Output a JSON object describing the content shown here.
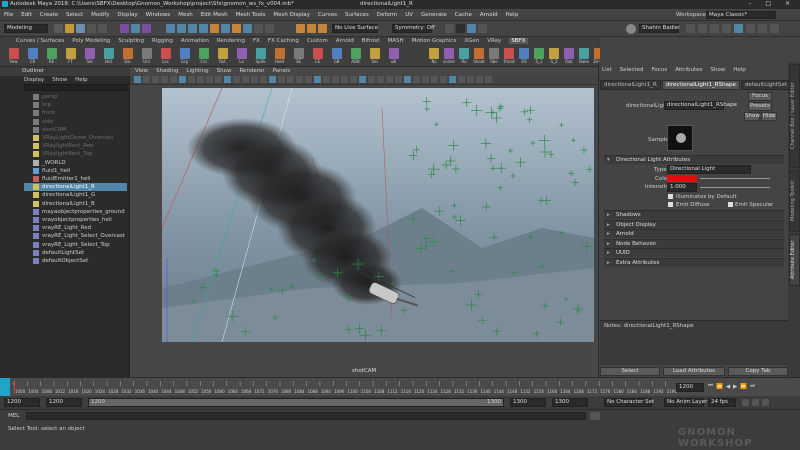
{
  "title_bar": {
    "title": "Autodesk Maya 2018: C:\\Users\\SBFX\\Desktop\\Gnomon_Workshop\\project\\Sfx\\gnomon_ws_fx_v004.mb*",
    "center": "directionalLight1_R",
    "window_controls": "– □ ×"
  },
  "menu_bar": {
    "items": [
      "File",
      "Edit",
      "Create",
      "Select",
      "Modify",
      "Display",
      "Windows",
      "Mesh",
      "Edit Mesh",
      "Mesh Tools",
      "Mesh Display",
      "Curves",
      "Surfaces",
      "Deform",
      "UV",
      "Generate",
      "Cache",
      "Arnold",
      "Help"
    ],
    "workspace_label": "Workspace :",
    "workspace_value": "Maya Classic*"
  },
  "status_line": {
    "menu_set": "Modeling",
    "live_surface": "No Live Surface",
    "symmetry": "Symmetry: Off",
    "user": "Shahin Badiei"
  },
  "shelf": {
    "tabs": [
      "Curves / Surfaces",
      "Poly Modeling",
      "Sculpting",
      "Rigging",
      "Animation",
      "Rendering",
      "FX",
      "FX Caching",
      "Custom",
      "Arnold",
      "Bifrost",
      "MASH",
      "Motion Graphics",
      "XGen",
      "VRay",
      "SBFX"
    ],
    "active_tab": "SBFX",
    "icon_labels": [
      "Vew",
      "CR",
      "RE",
      "FT",
      "Sel",
      "Hid",
      "Dis",
      "Unl",
      "Loc",
      "Grp",
      "Cel",
      "Rst",
      "Lo",
      "SpSk",
      "Hold",
      "SE",
      "CE",
      "GB",
      "ADB",
      "Sel",
      "uB"
    ],
    "right_icon_labels": [
      "Ns",
      "scene",
      "Ro",
      "Shoot",
      "Sbe",
      "Trand",
      "OS",
      "S_1",
      "S_2",
      "Rak",
      "Bake",
      "Zoom"
    ]
  },
  "toolbox": {
    "tools": [
      "select-tool",
      "lasso-tool",
      "paint-select-tool",
      "move-tool",
      "rotate-tool",
      "scale-tool",
      "last-tool"
    ]
  },
  "outliner": {
    "title": "Outliner",
    "menus": [
      "Display",
      "Show",
      "Help"
    ],
    "items": [
      {
        "label": "persp",
        "dim": true,
        "icon": "camera-icon"
      },
      {
        "label": "top",
        "dim": true,
        "icon": "camera-icon"
      },
      {
        "label": "front",
        "dim": true,
        "icon": "camera-icon"
      },
      {
        "label": "side",
        "dim": true,
        "icon": "camera-icon"
      },
      {
        "label": "shotCAM",
        "dim": true,
        "icon": "camera-icon"
      },
      {
        "label": "VRayLightDome_Overcast",
        "dim": true,
        "icon": "light-icon"
      },
      {
        "label": "VRaylightRect_Red",
        "dim": true,
        "icon": "light-icon"
      },
      {
        "label": "VRaylightRect_Top",
        "dim": true,
        "icon": "light-icon"
      },
      {
        "label": "_WORLD",
        "dim": false,
        "icon": "group-icon"
      },
      {
        "label": "fluid1_heli",
        "dim": false,
        "icon": "fluid-icon"
      },
      {
        "label": "fluidEmitter1_heli",
        "dim": false,
        "icon": "emitter-icon"
      },
      {
        "label": "directionalLight1_R",
        "dim": false,
        "icon": "light-icon",
        "selected": true
      },
      {
        "label": "directionalLight1_G",
        "dim": false,
        "icon": "light-icon"
      },
      {
        "label": "directionalLight1_B",
        "dim": false,
        "icon": "light-icon"
      },
      {
        "label": "mayaobjectproperties_ground",
        "dim": false,
        "icon": "set-icon"
      },
      {
        "label": "vrayobjectproperties_heli",
        "dim": false,
        "icon": "set-icon"
      },
      {
        "label": "vrayRE_Light_Red",
        "dim": false,
        "icon": "set-icon"
      },
      {
        "label": "vrayRE_Light_Select_Overcast",
        "dim": false,
        "icon": "set-icon"
      },
      {
        "label": "vrayRE_Light_Select_Top",
        "dim": false,
        "icon": "set-icon"
      },
      {
        "label": "defaultLightSet",
        "dim": false,
        "icon": "set-icon"
      },
      {
        "label": "defaultObjectSet",
        "dim": false,
        "icon": "set-icon"
      }
    ]
  },
  "viewport": {
    "menus": [
      "View",
      "Shading",
      "Lighting",
      "Show",
      "Renderer",
      "Panels"
    ],
    "camera_label": "shotCAM"
  },
  "attribute_editor": {
    "menus": [
      "List",
      "Selected",
      "Focus",
      "Attributes",
      "Show",
      "Help"
    ],
    "tabs": [
      "directionalLight1_R",
      "directionalLight1_RShape",
      "defaultLightSet"
    ],
    "active_tab": "directionalLight1_RShape",
    "node_label": "directionalLight:",
    "node_value": "directionalLight1_RShape",
    "buttons": {
      "focus": "Focus",
      "presets": "Presets",
      "show": "Show",
      "hide": "Hide"
    },
    "sample_label": "Sample",
    "sections": {
      "dir_light": "Directional Light Attributes",
      "type_label": "Type",
      "type_value": "Directional Light",
      "color_label": "Color",
      "color_swatch": "#e01010",
      "intensity_label": "Intensity",
      "intensity_value": "1.000",
      "illum_default": "Illuminates by Default",
      "emit_diffuse": "Emit Diffuse",
      "emit_specular": "Emit Specular",
      "collapsed": [
        "Shadows",
        "Object Display",
        "Arnold",
        "Node Behavior",
        "UUID",
        "Extra Attributes"
      ]
    },
    "notes_label": "Notes: directionalLight1_RShape",
    "bottom_buttons": [
      "Select",
      "Load Attributes",
      "Copy Tab"
    ],
    "side_tabs": [
      "Channel Box / Layer Editor",
      "Modeling Toolkit",
      "Attribute Editor"
    ]
  },
  "time_slider": {
    "ticks": [
      "1000",
      "1004",
      "1008",
      "1012",
      "1016",
      "1020",
      "1024",
      "1028",
      "1032",
      "1036",
      "1040",
      "1044",
      "1048",
      "1052",
      "1056",
      "1060",
      "1064",
      "1068",
      "1072",
      "1076",
      "1080",
      "1084",
      "1088",
      "1092",
      "1096",
      "1100",
      "1104",
      "1108",
      "1112",
      "1116",
      "1120",
      "1124",
      "1128",
      "1132",
      "1136",
      "1140",
      "1144",
      "1148",
      "1152",
      "1156",
      "1160",
      "1164",
      "1168",
      "1172",
      "1176",
      "1180",
      "1184",
      "1188",
      "1192",
      "1196"
    ],
    "current_frame": "1200"
  },
  "range_slider": {
    "start": "1200",
    "inner_start": "1200",
    "range_start": "1200",
    "range_end": "1300",
    "end": "1300",
    "end2": "1300",
    "char_set": "No Character Set",
    "anim_layer": "No Anim Layer",
    "fps": "24 fps"
  },
  "command_line": {
    "label": "MEL"
  },
  "help_line": {
    "text": "Select Tool: select an object"
  },
  "watermark": "GNOMON WORKSHOP"
}
